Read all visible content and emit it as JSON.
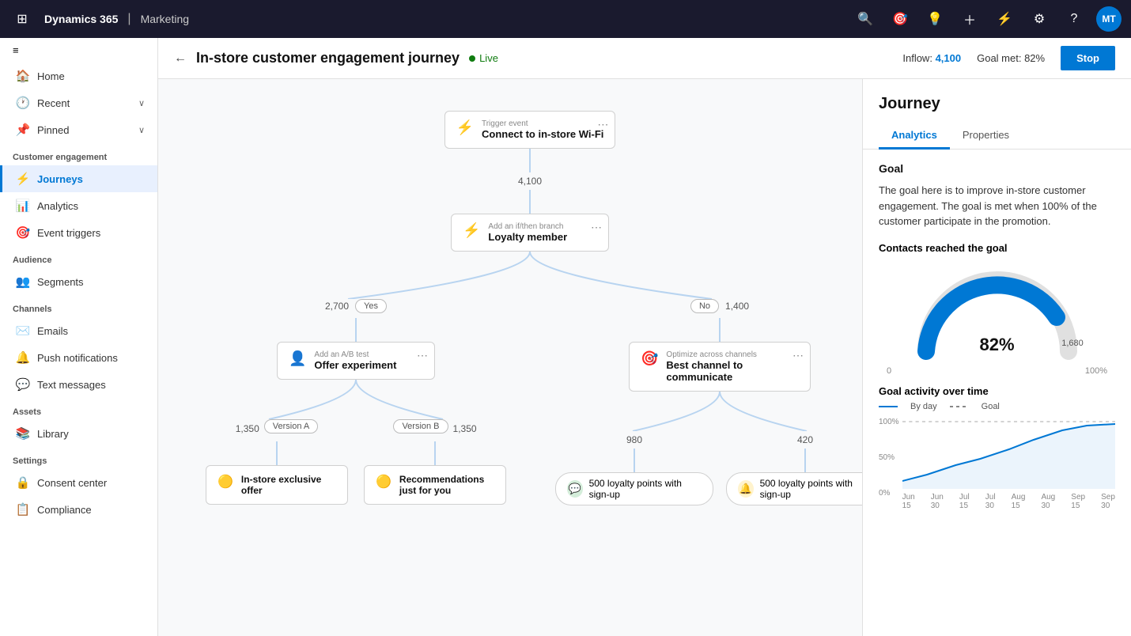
{
  "app": {
    "brand": "Dynamics 365",
    "divider": "|",
    "module": "Marketing"
  },
  "topnav": {
    "icons": [
      "grid-icon",
      "search-icon",
      "target-icon",
      "lightbulb-icon",
      "plus-icon",
      "filter-icon",
      "gear-icon",
      "help-icon"
    ],
    "avatar": "MT"
  },
  "sidebar": {
    "collapse_icon": "≡",
    "nav_items": [
      {
        "id": "home",
        "label": "Home",
        "icon": "🏠"
      },
      {
        "id": "recent",
        "label": "Recent",
        "icon": "🕐",
        "expand": true
      },
      {
        "id": "pinned",
        "label": "Pinned",
        "icon": "📌",
        "expand": true
      }
    ],
    "sections": [
      {
        "label": "Customer engagement",
        "items": [
          {
            "id": "journeys",
            "label": "Journeys",
            "icon": "⚡",
            "active": true
          },
          {
            "id": "analytics",
            "label": "Analytics",
            "icon": "📊"
          },
          {
            "id": "event-triggers",
            "label": "Event triggers",
            "icon": "🎯"
          }
        ]
      },
      {
        "label": "Audience",
        "items": [
          {
            "id": "segments",
            "label": "Segments",
            "icon": "👥"
          }
        ]
      },
      {
        "label": "Channels",
        "items": [
          {
            "id": "emails",
            "label": "Emails",
            "icon": "✉️"
          },
          {
            "id": "push-notifications",
            "label": "Push notifications",
            "icon": "🔔"
          },
          {
            "id": "text-messages",
            "label": "Text messages",
            "icon": "💬"
          }
        ]
      },
      {
        "label": "Assets",
        "items": [
          {
            "id": "library",
            "label": "Library",
            "icon": "📚"
          }
        ]
      },
      {
        "label": "Settings",
        "items": [
          {
            "id": "consent-center",
            "label": "Consent center",
            "icon": "🔒"
          },
          {
            "id": "compliance",
            "label": "Compliance",
            "icon": "📋"
          }
        ]
      }
    ]
  },
  "header": {
    "back_label": "←",
    "title": "In-store customer engagement journey",
    "status": "Live",
    "inflow_label": "Inflow:",
    "inflow_value": "4,100",
    "goal_label": "Goal met: 82%",
    "stop_label": "Stop"
  },
  "journey": {
    "nodes": {
      "trigger": {
        "label": "Trigger event",
        "title": "Connect to in-store Wi-Fi"
      },
      "inflow_count": "4,100",
      "branch": {
        "label": "Add an if/then branch",
        "title": "Loyalty member"
      },
      "yes_label": "Yes",
      "yes_count": "2,700",
      "no_label": "No",
      "no_count": "1,400",
      "ab_test": {
        "label": "Add an A/B test",
        "title": "Offer experiment"
      },
      "optimize": {
        "label": "Optimize across channels",
        "title": "Best channel to communicate"
      },
      "version_a": "Version A",
      "version_b": "Version B",
      "left_count": "1,350",
      "mid_count": "1,350",
      "right_980": "980",
      "right_420": "420",
      "node_instore": "In-store exclusive offer",
      "node_recs": "Recommendations just for you",
      "channel_500a_label": "500 loyalty points with sign-up",
      "channel_500b_label": "500 loyalty points with sign-up"
    }
  },
  "right_panel": {
    "title": "Journey",
    "tabs": [
      {
        "id": "analytics",
        "label": "Analytics",
        "active": true
      },
      {
        "id": "properties",
        "label": "Properties",
        "active": false
      }
    ],
    "goal_section": {
      "title": "Goal",
      "description": "The goal here is to improve in-store customer engagement. The goal is met when 100% of the customer participate in the promotion."
    },
    "contacts_section": {
      "title": "Contacts reached the goal",
      "percent": "82%",
      "min_label": "0",
      "max_label": "100%",
      "value_label": "1,680"
    },
    "activity_section": {
      "title": "Goal activity over time",
      "legend_by_day": "By day",
      "legend_goal": "Goal",
      "y_labels": [
        "100%",
        "50%",
        "0%"
      ],
      "x_labels": [
        "Jun 15",
        "Jun 30",
        "Jul 15",
        "Jul 30",
        "Aug 15",
        "Aug 30",
        "Sep 15",
        "Sep 30"
      ],
      "chart_line_color": "#0078d4",
      "chart_goal_color": "#888"
    }
  }
}
